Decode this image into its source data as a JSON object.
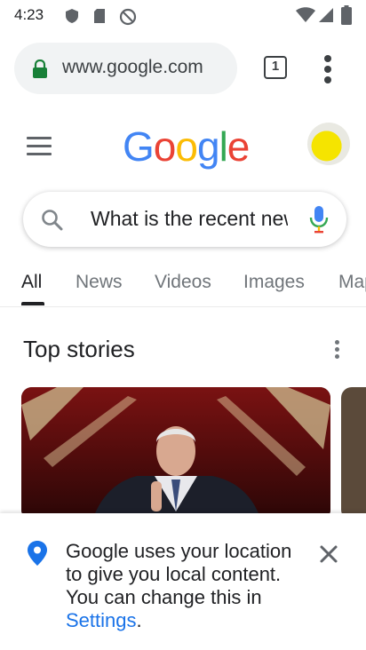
{
  "status_bar": {
    "time": "4:23",
    "icons": [
      "play-protect-icon",
      "sd-card-icon",
      "at-icon",
      "wifi-icon",
      "signal-icon",
      "battery-icon"
    ]
  },
  "browser": {
    "url": "www.google.com",
    "tab_count": "1"
  },
  "google": {
    "logo_letters": [
      "G",
      "o",
      "o",
      "g",
      "l",
      "e"
    ],
    "logo_colors": [
      "#4285F4",
      "#EA4335",
      "#FBBC05",
      "#4285F4",
      "#34A853",
      "#EA4335"
    ]
  },
  "search": {
    "query": "What is the recent news"
  },
  "tabs": [
    "All",
    "News",
    "Videos",
    "Images",
    "Maps"
  ],
  "top_stories": {
    "title": "Top stories"
  },
  "location_banner": {
    "text": "Google uses your location to give you local content. You can change this in",
    "link": "Settings",
    "suffix": "."
  },
  "colors": {
    "accent_blue": "#1a73e8",
    "lock_green": "#188038"
  }
}
